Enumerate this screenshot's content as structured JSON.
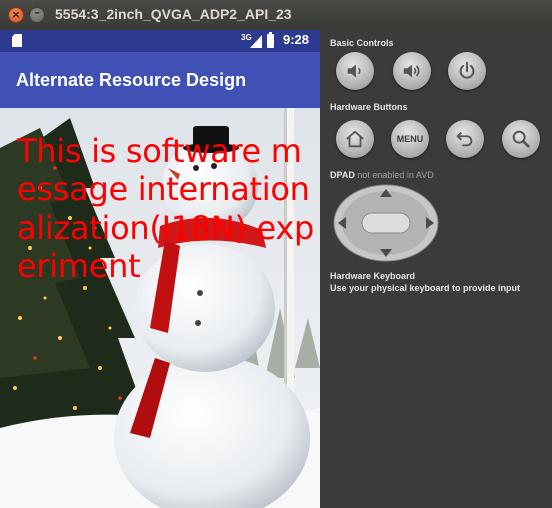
{
  "window": {
    "title": "5554:3_2inch_QVGA_ADP2_API_23"
  },
  "statusbar": {
    "network": "3G",
    "time": "9:28"
  },
  "app": {
    "title": "Alternate Resource Design",
    "message": "This is software message internationalization(I18N) experiment"
  },
  "panel": {
    "basic_controls": "Basic Controls",
    "hardware_buttons": "Hardware Buttons",
    "menu_label": "MENU",
    "dpad_label": "DPAD",
    "dpad_note": "not enabled in AVD",
    "keyboard_label": "Hardware Keyboard",
    "keyboard_note": "Use your physical keyboard to provide input"
  },
  "icons": {
    "volume_down": "volume-down-icon",
    "volume_up": "volume-up-icon",
    "power": "power-icon",
    "home": "home-icon",
    "back": "back-icon",
    "search": "search-icon"
  }
}
